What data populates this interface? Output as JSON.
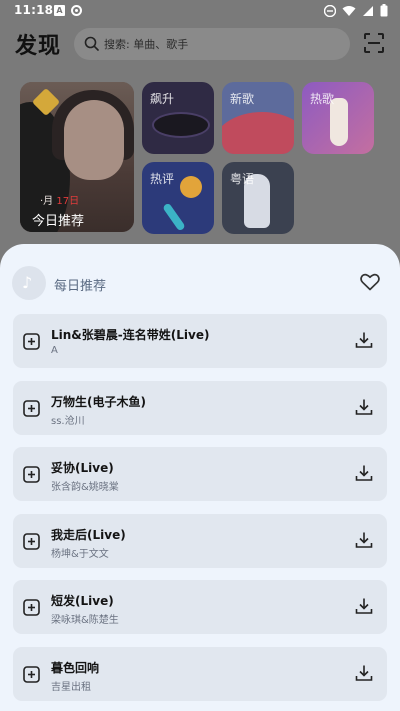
{
  "status_bar": {
    "time": "11:18",
    "badge_letter": "A"
  },
  "header": {
    "title": "发现",
    "search_placeholder": "搜索: 单曲、歌手"
  },
  "tiles": {
    "daily": {
      "date_month": "·月",
      "date_day": "17日",
      "title": "今日推荐"
    },
    "soar": "飙升",
    "new": "新歌",
    "hot": "热歌",
    "review": "热评",
    "canto": "粤语"
  },
  "sheet": {
    "title": "每日推荐",
    "songs": [
      {
        "name": "Lin&张碧晨-连名带姓(Live)",
        "artist": "A"
      },
      {
        "name": "万物生(电子木鱼)",
        "artist": "ss.沧川"
      },
      {
        "name": "妥协(Live)",
        "artist": "张含韵&姚晓棠"
      },
      {
        "name": "我走后(Live)",
        "artist": "杨坤&于文文"
      },
      {
        "name": "短发(Live)",
        "artist": "梁咏琪&陈楚生"
      },
      {
        "name": "暮色回响",
        "artist": "吉星出租"
      }
    ]
  },
  "colors": {
    "sheet_bg": "#eef4fc",
    "card_bg": "#e1e7ef",
    "accent_date": "#e03b3b"
  }
}
